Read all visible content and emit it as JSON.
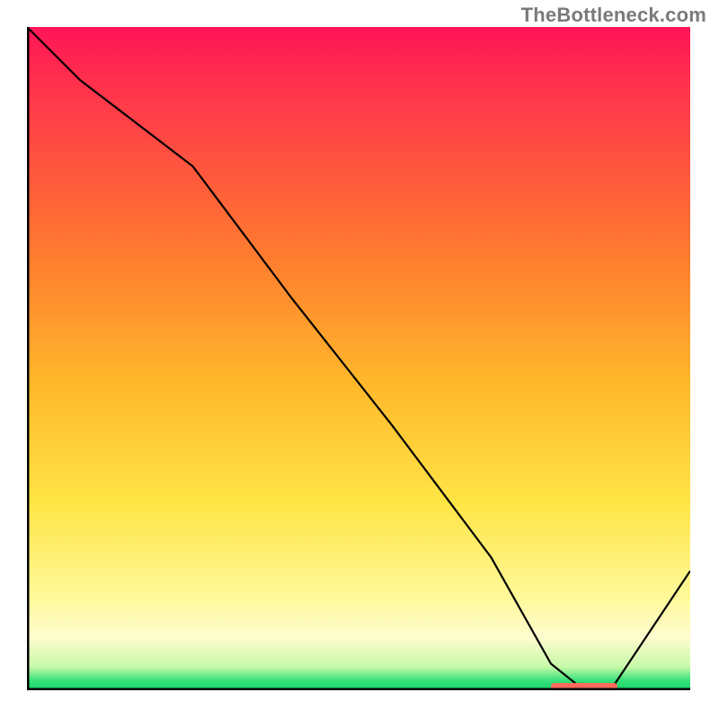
{
  "watermark": "TheBottleneck.com",
  "chart_data": {
    "type": "line",
    "title": "",
    "xlabel": "",
    "ylabel": "",
    "xlim": [
      0,
      100
    ],
    "ylim": [
      0,
      100
    ],
    "series": [
      {
        "name": "curve",
        "x": [
          0,
          8,
          25,
          40,
          55,
          70,
          79,
          84,
          88,
          100
        ],
        "values": [
          100,
          92,
          79,
          59,
          40,
          20,
          4,
          0,
          0,
          18
        ]
      }
    ],
    "marker_segment": {
      "x_start": 79,
      "x_end": 89,
      "y": 0.6
    },
    "background_gradient_note": "vertical gradient red→orange→yellow→pale→green (heat-map style)"
  },
  "colors": {
    "axis": "#000000",
    "curve": "#000000",
    "marker": "#ff6a5b",
    "watermark": "#7a7a7a"
  }
}
